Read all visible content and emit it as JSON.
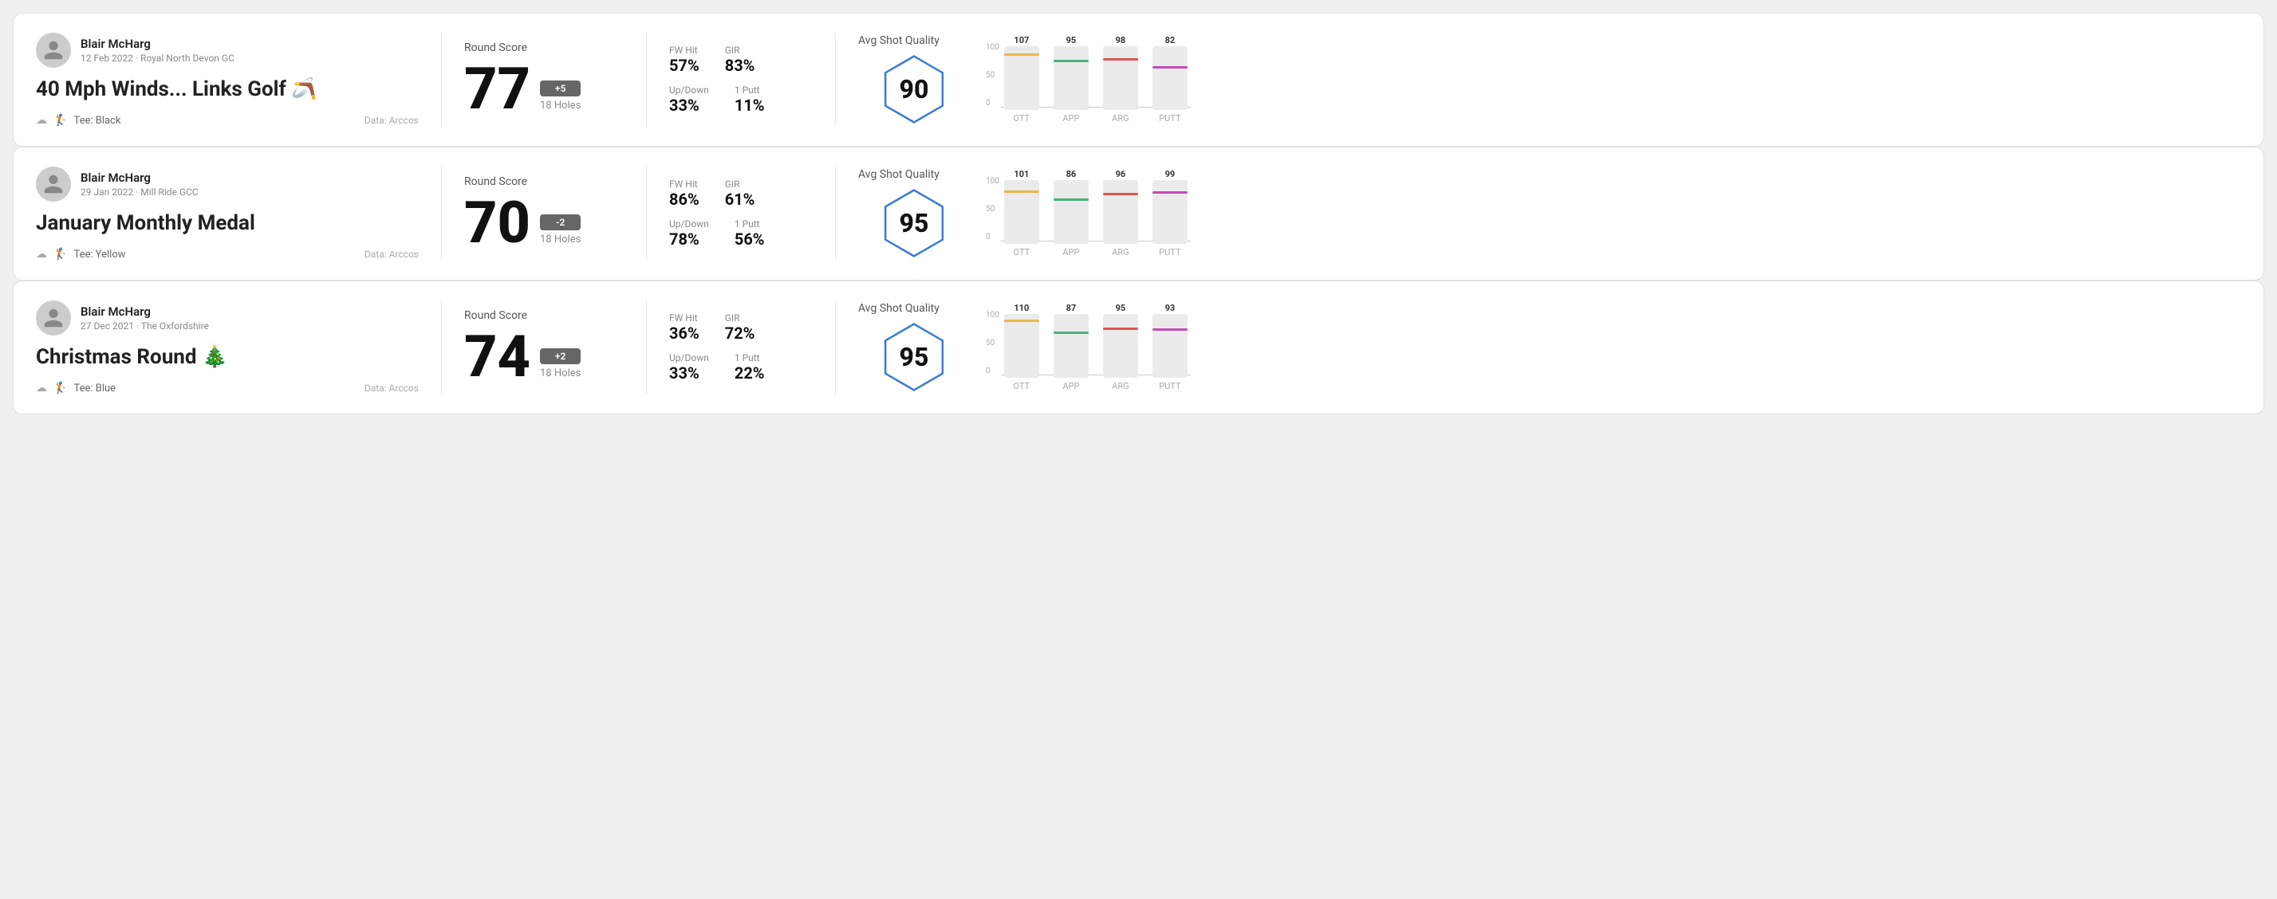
{
  "rounds": [
    {
      "id": "round-1",
      "user": {
        "name": "Blair McHarg",
        "date": "12 Feb 2022",
        "course": "Royal North Devon GC"
      },
      "title": "40 Mph Winds... Links Golf 🪃",
      "tee": "Black",
      "data_source": "Data: Arccos",
      "score": {
        "label": "Round Score",
        "value": "77",
        "badge": "+5",
        "badge_type": "positive",
        "holes": "18 Holes"
      },
      "stats": {
        "fw_hit_label": "FW Hit",
        "fw_hit_value": "57%",
        "gir_label": "GIR",
        "gir_value": "83%",
        "updown_label": "Up/Down",
        "updown_value": "33%",
        "oneputt_label": "1 Putt",
        "oneputt_value": "11%"
      },
      "shot_quality": {
        "label": "Avg Shot Quality",
        "value": "90"
      },
      "chart": {
        "bars": [
          {
            "label": "OTT",
            "value": 107,
            "color": "#e8b84b"
          },
          {
            "label": "APP",
            "value": 95,
            "color": "#4caf82"
          },
          {
            "label": "ARG",
            "value": 98,
            "color": "#e05252"
          },
          {
            "label": "PUTT",
            "value": 82,
            "color": "#c44bb5"
          }
        ],
        "y_max": 100,
        "y_labels": [
          "100",
          "50",
          "0"
        ]
      }
    },
    {
      "id": "round-2",
      "user": {
        "name": "Blair McHarg",
        "date": "29 Jan 2022",
        "course": "Mill Ride GCC"
      },
      "title": "January Monthly Medal",
      "tee": "Yellow",
      "data_source": "Data: Arccos",
      "score": {
        "label": "Round Score",
        "value": "70",
        "badge": "-2",
        "badge_type": "negative",
        "holes": "18 Holes"
      },
      "stats": {
        "fw_hit_label": "FW Hit",
        "fw_hit_value": "86%",
        "gir_label": "GIR",
        "gir_value": "61%",
        "updown_label": "Up/Down",
        "updown_value": "78%",
        "oneputt_label": "1 Putt",
        "oneputt_value": "56%"
      },
      "shot_quality": {
        "label": "Avg Shot Quality",
        "value": "95"
      },
      "chart": {
        "bars": [
          {
            "label": "OTT",
            "value": 101,
            "color": "#e8b84b"
          },
          {
            "label": "APP",
            "value": 86,
            "color": "#4caf82"
          },
          {
            "label": "ARG",
            "value": 96,
            "color": "#e05252"
          },
          {
            "label": "PUTT",
            "value": 99,
            "color": "#c44bb5"
          }
        ],
        "y_max": 100,
        "y_labels": [
          "100",
          "50",
          "0"
        ]
      }
    },
    {
      "id": "round-3",
      "user": {
        "name": "Blair McHarg",
        "date": "27 Dec 2021",
        "course": "The Oxfordshire"
      },
      "title": "Christmas Round 🎄",
      "tee": "Blue",
      "data_source": "Data: Arccos",
      "score": {
        "label": "Round Score",
        "value": "74",
        "badge": "+2",
        "badge_type": "positive",
        "holes": "18 Holes"
      },
      "stats": {
        "fw_hit_label": "FW Hit",
        "fw_hit_value": "36%",
        "gir_label": "GIR",
        "gir_value": "72%",
        "updown_label": "Up/Down",
        "updown_value": "33%",
        "oneputt_label": "1 Putt",
        "oneputt_value": "22%"
      },
      "shot_quality": {
        "label": "Avg Shot Quality",
        "value": "95"
      },
      "chart": {
        "bars": [
          {
            "label": "OTT",
            "value": 110,
            "color": "#e8b84b"
          },
          {
            "label": "APP",
            "value": 87,
            "color": "#4caf82"
          },
          {
            "label": "ARG",
            "value": 95,
            "color": "#e05252"
          },
          {
            "label": "PUTT",
            "value": 93,
            "color": "#c44bb5"
          }
        ],
        "y_max": 100,
        "y_labels": [
          "100",
          "50",
          "0"
        ]
      }
    }
  ]
}
